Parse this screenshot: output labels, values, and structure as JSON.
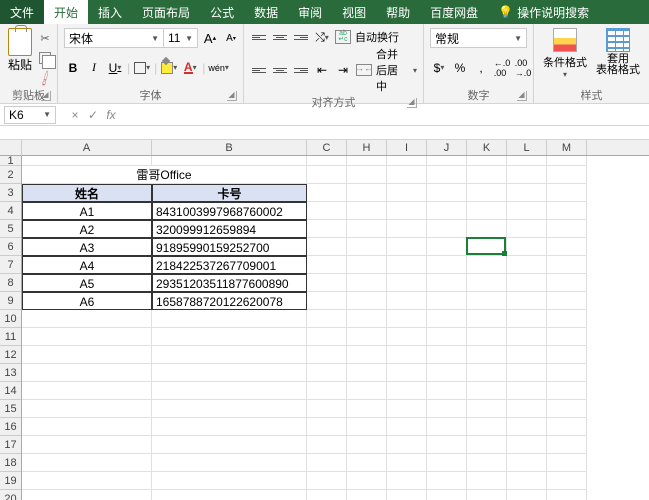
{
  "tabs": {
    "file": "文件",
    "home": "开始",
    "insert": "插入",
    "layout": "页面布局",
    "formula": "公式",
    "data": "数据",
    "review": "审阅",
    "view": "视图",
    "help": "帮助",
    "baidu": "百度网盘",
    "tell": "操作说明搜索"
  },
  "ribbon": {
    "clipboard": {
      "paste": "粘贴",
      "label": "剪贴板"
    },
    "font": {
      "name": "宋体",
      "size": "11",
      "grow": "A",
      "shrink": "A",
      "bold": "B",
      "italic": "I",
      "underline": "U",
      "phonetic": "wén",
      "label": "字体"
    },
    "align": {
      "wrap": "自动换行",
      "merge": "合并后居中",
      "label": "对齐方式"
    },
    "number": {
      "format": "常规",
      "currency": "$",
      "percent": "%",
      "comma": ",",
      "inc": ".0",
      "dec": ".00",
      "label": "数字"
    },
    "styles": {
      "cond": "条件格式",
      "table": "套用\n表格格式",
      "label": "样式"
    }
  },
  "namebox": "K6",
  "fx": "fx",
  "fxbtns": {
    "cancel": "×",
    "confirm": "✓"
  },
  "colWidths": {
    "A": 130,
    "B": 155,
    "default": 40
  },
  "cols": [
    "A",
    "B",
    "C",
    "H",
    "I",
    "J",
    "K",
    "L",
    "M"
  ],
  "rowCount": 21,
  "titleRow": {
    "text": "雷哥Office"
  },
  "headers": {
    "name": "姓名",
    "card": "卡号"
  },
  "rows": [
    {
      "name": "A1",
      "card": "8431003997968760002"
    },
    {
      "name": "A2",
      "card": "320099912659894"
    },
    {
      "name": "A3",
      "card": "91895990159252700"
    },
    {
      "name": "A4",
      "card": "218422537267709001"
    },
    {
      "name": "A5",
      "card": "29351203511877600890"
    },
    {
      "name": "A6",
      "card": "1658788720122620078"
    }
  ],
  "selection": {
    "col": "K",
    "row": 6
  }
}
